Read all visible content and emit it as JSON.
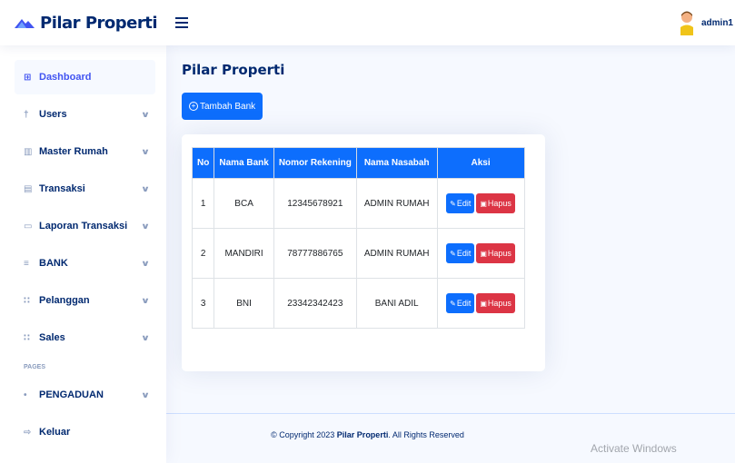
{
  "header": {
    "logo_text": "Pilar Properti",
    "user_name": "admin1"
  },
  "sidebar": {
    "items": [
      {
        "label": "Dashboard",
        "icon": "grid-icon"
      },
      {
        "label": "Users",
        "icon": "person-icon"
      },
      {
        "label": "Master Rumah",
        "icon": "building-icon"
      },
      {
        "label": "Transaksi",
        "icon": "receipt-icon"
      },
      {
        "label": "Laporan Transaksi",
        "icon": "folder-icon"
      },
      {
        "label": "BANK",
        "icon": "bank-icon"
      },
      {
        "label": "Pelanggan",
        "icon": "people-icon"
      },
      {
        "label": "Sales",
        "icon": "people-icon"
      }
    ],
    "pages_heading": "PAGES",
    "pengaduan": {
      "label": "PENGADUAN",
      "icon": "pin-icon"
    },
    "keluar": {
      "label": "Keluar",
      "icon": "logout-icon"
    }
  },
  "main": {
    "page_title": "Pilar Properti",
    "add_button": "Tambah Bank",
    "table": {
      "headers": [
        "No",
        "Nama Bank",
        "Nomor Rekening",
        "Nama Nasabah",
        "Aksi"
      ],
      "rows": [
        {
          "no": "1",
          "bank": "BCA",
          "rekening": "12345678921",
          "nasabah": "ADMIN RUMAH"
        },
        {
          "no": "2",
          "bank": "MANDIRI",
          "rekening": "78777886765",
          "nasabah": "ADMIN RUMAH"
        },
        {
          "no": "3",
          "bank": "BNI",
          "rekening": "23342342423",
          "nasabah": "BANI ADIL"
        }
      ],
      "edit_label": "Edit",
      "delete_label": "Hapus"
    }
  },
  "footer": {
    "prefix": "© Copyright 2023 ",
    "brand": "Pilar Properti",
    "suffix": ". All Rights Reserved"
  },
  "watermark": "Activate Windows",
  "colors": {
    "primary": "#0d6efd",
    "danger": "#dc3545",
    "navy": "#012970",
    "accent": "#4154f1"
  }
}
